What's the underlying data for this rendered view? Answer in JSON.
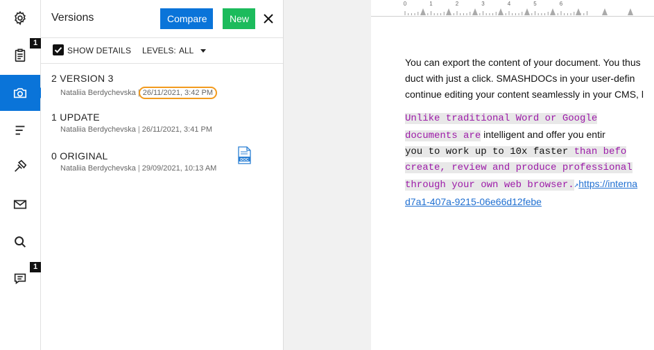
{
  "rail": {
    "badges": {
      "tasks": "1",
      "comments": "1"
    }
  },
  "panel": {
    "title": "Versions",
    "compare_label": "Compare",
    "new_label": "New",
    "show_details_label": "SHOW DETAILS",
    "show_details_checked": true,
    "levels_label": "LEVELS:",
    "levels_value": "ALL"
  },
  "versions": [
    {
      "number": "2",
      "title": "VERSION 3",
      "author": "Nataliia Berdychevska",
      "date": "26/11/2021, 3:42 PM",
      "highlighted": true
    },
    {
      "number": "1",
      "title": "UPDATE",
      "author": "Nataliia Berdychevska",
      "date": "26/11/2021, 3:41 PM"
    },
    {
      "number": "0",
      "title": "ORIGINAL",
      "author": "Nataliia Berdychevska",
      "date": "29/09/2021, 10:13 AM",
      "has_doc": true
    }
  ],
  "doc_icon_label": "DOC",
  "ruler": {
    "labels": [
      "0",
      "1",
      "2",
      "3",
      "4",
      "5",
      "6"
    ]
  },
  "document": {
    "p1": [
      "You can export the content of your document. You thus",
      "duct with just a click. SMASHDOCs in your user-defin",
      "continue editing your content seamlessly in your CMS, l"
    ],
    "p2": {
      "l1_mark": "Unlike  traditional  Word  or  Google",
      "l2_mark": "documents are",
      "l2_plain": " intelligent and offer you entir",
      "l3_plain": "you  to  work  up  to  10x  faster",
      "l3_mark": " than befo",
      "l4_mark": "create, review and produce professional",
      "l5_mark": "through your own web browser.",
      "l5_link": "https://interna",
      "l6_link": "d7a1-407a-9215-06e66d12febe"
    }
  },
  "colors": {
    "accent": "#0a74d9",
    "new_button": "#1cbb5c",
    "highlight_ring": "#f29a1d",
    "track_text": "#9c1aa8",
    "link": "#1f6fd1"
  }
}
